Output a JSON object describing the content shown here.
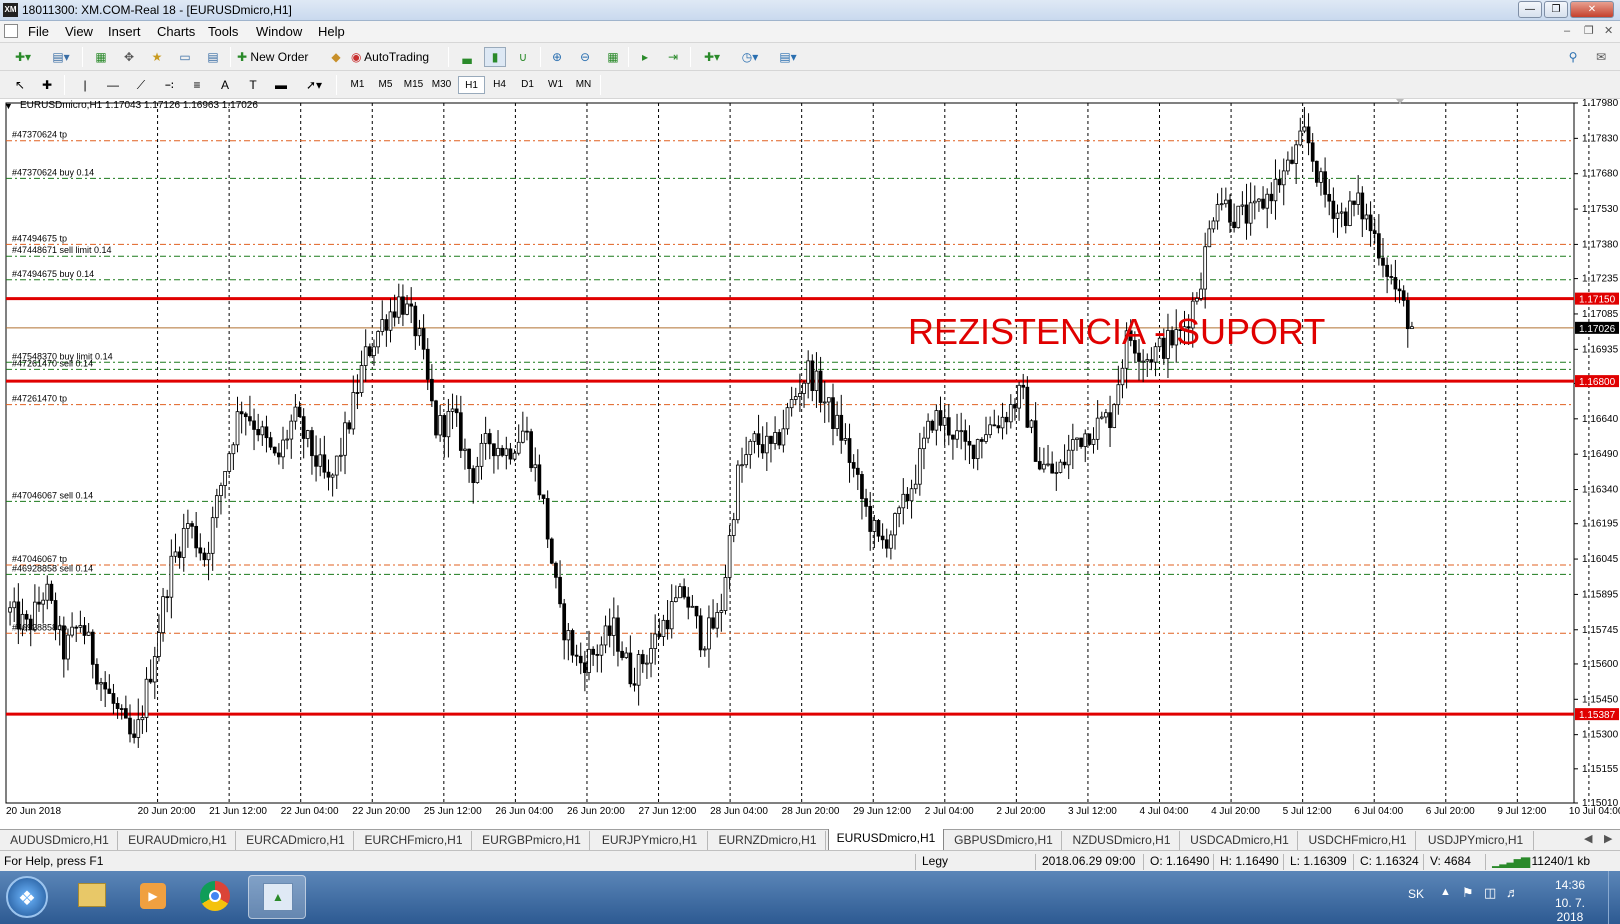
{
  "window": {
    "logo": "XM",
    "title": "18011300: XM.COM-Real 18 - [EURUSDmicro,H1]"
  },
  "menu": [
    "File",
    "View",
    "Insert",
    "Charts",
    "Tools",
    "Window",
    "Help"
  ],
  "toolbar": {
    "new_order": "New Order",
    "autotrading": "AutoTrading"
  },
  "timeframes": [
    "M1",
    "M5",
    "M15",
    "M30",
    "H1",
    "H4",
    "D1",
    "W1",
    "MN"
  ],
  "active_timeframe": "H1",
  "chart": {
    "header": "EURUSDmicro,H1  1.17043 1.17126 1.16963 1.17026",
    "annotation": "REZISTENCIA - SUPORT",
    "order_labels": [
      {
        "text": "#47370624 tp",
        "price": 1.1782
      },
      {
        "text": "#47370624 buy 0.14",
        "price": 1.1766
      },
      {
        "text": "#47494675 tp",
        "price": 1.1738
      },
      {
        "text": "#47448671 sell limit 0.14",
        "price": 1.1733
      },
      {
        "text": "#47494675 buy 0.14",
        "price": 1.1723
      },
      {
        "text": "#47548370 buy limit 0.14",
        "price": 1.1688
      },
      {
        "text": "#47261470 sell 0.14",
        "price": 1.1685
      },
      {
        "text": "#47261470 tp",
        "price": 1.167
      },
      {
        "text": "#47046067 sell 0.14",
        "price": 1.1629
      },
      {
        "text": "#47046067 tp",
        "price": 1.1602
      },
      {
        "text": "#46928858 sell 0.14",
        "price": 1.1598
      },
      {
        "text": "#46928858 tp",
        "price": 1.1573
      }
    ],
    "support_resistance": [
      {
        "price": 1.1715,
        "label": "1.17150"
      },
      {
        "price": 1.168,
        "label": "1.16800"
      },
      {
        "price": 1.15387,
        "label": "1.15387"
      }
    ],
    "price_axis": [
      "1.17980",
      "1.17830",
      "1.17680",
      "1.17530",
      "1.17380",
      "1.17235",
      "1.17085",
      "1.16935",
      "1.16790",
      "1.16640",
      "1.16490",
      "1.16340",
      "1.16195",
      "1.16045",
      "1.15895",
      "1.15745",
      "1.15600",
      "1.15450",
      "1.15300",
      "1.15155",
      "1.15010"
    ],
    "current_price": "1.17026",
    "time_axis": [
      "20 Jun 2018",
      "20 Jun 20:00",
      "21 Jun 12:00",
      "22 Jun 04:00",
      "22 Jun 20:00",
      "25 Jun 12:00",
      "26 Jun 04:00",
      "26 Jun 20:00",
      "27 Jun 12:00",
      "28 Jun 04:00",
      "28 Jun 20:00",
      "29 Jun 12:00",
      "2 Jul 04:00",
      "2 Jul 20:00",
      "3 Jul 12:00",
      "4 Jul 04:00",
      "4 Jul 20:00",
      "5 Jul 12:00",
      "6 Jul 04:00",
      "6 Jul 20:00",
      "9 Jul 12:00",
      "10 Jul 04:00"
    ],
    "colors": {
      "sr_line": "#e00000",
      "tp_line": "#e06020",
      "order_line": "#1c7a1c",
      "bull_candle": "#ffffff",
      "bear_candle": "#000000",
      "annotation": "#e00000"
    }
  },
  "chart_data": {
    "type": "candlestick",
    "symbol": "EURUSDmicro",
    "timeframe": "H1",
    "ylim": [
      1.1501,
      1.1798
    ],
    "key_levels": [
      1.1715,
      1.168,
      1.15387
    ],
    "path": [
      1.1582,
      1.1575,
      1.1592,
      1.1565,
      1.1578,
      1.1555,
      1.154,
      1.1525,
      1.156,
      1.16,
      1.162,
      1.1605,
      1.164,
      1.167,
      1.166,
      1.1645,
      1.1665,
      1.165,
      1.1635,
      1.166,
      1.169,
      1.1705,
      1.1715,
      1.17,
      1.166,
      1.1665,
      1.164,
      1.1655,
      1.165,
      1.166,
      1.163,
      1.158,
      1.156,
      1.1565,
      1.1575,
      1.1555,
      1.1565,
      1.158,
      1.159,
      1.157,
      1.158,
      1.164,
      1.1655,
      1.165,
      1.167,
      1.1685,
      1.167,
      1.1655,
      1.163,
      1.161,
      1.162,
      1.164,
      1.1665,
      1.166,
      1.165,
      1.166,
      1.1665,
      1.1675,
      1.1645,
      1.164,
      1.1655,
      1.166,
      1.1665,
      1.17,
      1.169,
      1.1695,
      1.17,
      1.172,
      1.176,
      1.175,
      1.175,
      1.176,
      1.177,
      1.1785,
      1.176,
      1.175,
      1.1755,
      1.174,
      1.172,
      1.1703
    ]
  },
  "tabs": [
    "AUDUSDmicro,H1",
    "EURAUDmicro,H1",
    "EURCADmicro,H1",
    "EURCHFmicro,H1",
    "EURGBPmicro,H1",
    "EURJPYmicro,H1",
    "EURNZDmicro,H1",
    "EURUSDmicro,H1",
    "GBPUSDmicro,H1",
    "NZDUSDmicro,H1",
    "USDCADmicro,H1",
    "USDCHFmicro,H1",
    "USDJPYmicro,H1"
  ],
  "active_tab": "EURUSDmicro,H1",
  "status": {
    "help": "For Help, press F1",
    "profile": "Legy",
    "datetime": "2018.06.29 09:00",
    "open": "O: 1.16490",
    "high": "H: 1.16490",
    "low": "L: 1.16309",
    "close": "C: 1.16324",
    "volume": "V: 4684",
    "traffic": "11240/1 kb"
  },
  "taskbar": {
    "lang": "SK",
    "time": "14:36",
    "date": "10. 7. 2018"
  }
}
